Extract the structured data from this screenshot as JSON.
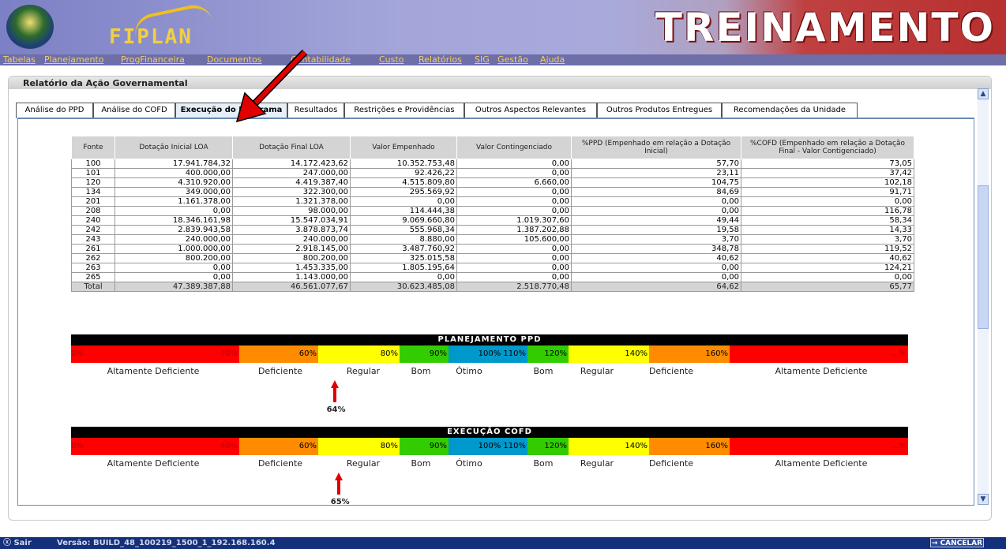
{
  "header": {
    "logo_text": "FIPLAN",
    "banner_text": "TREINAMENTO"
  },
  "menu": [
    "Tabelas",
    "Planejamento",
    "ProgFinanceira",
    "Documentos",
    "Contabilidade",
    "Custo",
    "Relatórios",
    "SIG",
    "Gestão",
    "Ajuda"
  ],
  "panel": {
    "title": "Relatório da Ação Governamental"
  },
  "tabs": [
    {
      "label": "Análise do PPD",
      "active": false
    },
    {
      "label": "Análise do COFD",
      "active": false
    },
    {
      "label": "Execução do Programa",
      "active": true
    },
    {
      "label": "Resultados",
      "active": false
    },
    {
      "label": "Restrições e Providências",
      "active": false
    },
    {
      "label": "Outros Aspectos Relevantes",
      "active": false
    },
    {
      "label": "Outros Produtos Entregues",
      "active": false
    },
    {
      "label": "Recomendações da Unidade",
      "active": false
    }
  ],
  "table": {
    "headers": [
      "Fonte",
      "Dotação Inicial LOA",
      "Dotação Final LOA",
      "Valor Empenhado",
      "Valor Contingenciado",
      "%PPD (Empenhado em relação a Dotação Inicial)",
      "%COFD (Empenhado em relação a Dotação Final - Valor Contigenciado)"
    ],
    "rows": [
      [
        "100",
        "17.941.784,32",
        "14.172.423,62",
        "10.352.753,48",
        "0,00",
        "57,70",
        "73,05"
      ],
      [
        "101",
        "400.000,00",
        "247.000,00",
        "92.426,22",
        "0,00",
        "23,11",
        "37,42"
      ],
      [
        "120",
        "4.310.920,00",
        "4.419.387,40",
        "4.515.809,80",
        "6.660,00",
        "104,75",
        "102,18"
      ],
      [
        "134",
        "349.000,00",
        "322.300,00",
        "295.569,92",
        "0,00",
        "84,69",
        "91,71"
      ],
      [
        "201",
        "1.161.378,00",
        "1.321.378,00",
        "0,00",
        "0,00",
        "0,00",
        "0,00"
      ],
      [
        "208",
        "0,00",
        "98.000,00",
        "114.444,38",
        "0,00",
        "0,00",
        "116,78"
      ],
      [
        "240",
        "18.346.161,98",
        "15.547.034,91",
        "9.069.660,80",
        "1.019.307,60",
        "49,44",
        "58,34"
      ],
      [
        "242",
        "2.839.943,58",
        "3.878.873,74",
        "555.968,34",
        "1.387.202,88",
        "19,58",
        "14,33"
      ],
      [
        "243",
        "240.000,00",
        "240.000,00",
        "8.880,00",
        "105.600,00",
        "3,70",
        "3,70"
      ],
      [
        "261",
        "1.000.000,00",
        "2.918.145,00",
        "3.487.760,92",
        "0,00",
        "348,78",
        "119,52"
      ],
      [
        "262",
        "800.200,00",
        "800.200,00",
        "325.015,58",
        "0,00",
        "40,62",
        "40,62"
      ],
      [
        "263",
        "0,00",
        "1.453.335,00",
        "1.805.195,64",
        "0,00",
        "0,00",
        "124,21"
      ],
      [
        "265",
        "0,00",
        "1.143.000,00",
        "0,00",
        "0,00",
        "0,00",
        "0,00"
      ]
    ],
    "total": [
      "Total",
      "47.389.387,88",
      "46.561.077,67",
      "30.623.485,08",
      "2.518.770,48",
      "64,62",
      "65,77"
    ]
  },
  "scale_segments": [
    {
      "label": "40%",
      "start": "0%",
      "color": "#ff0000"
    },
    {
      "label": "60%",
      "color": "#ff8c00"
    },
    {
      "label": "80%",
      "color": "#ffff00"
    },
    {
      "label": "90%",
      "color": "#33cc00"
    },
    {
      "label": "100%  110%",
      "color": "#0099cc"
    },
    {
      "label": "120%",
      "color": "#33cc00"
    },
    {
      "label": "140%",
      "color": "#ffff00"
    },
    {
      "label": "160%",
      "color": "#ff8c00"
    },
    {
      "label": "...%",
      "color": "#ff0000"
    }
  ],
  "scale_labels": [
    "Altamente Deficiente",
    "Deficiente",
    "Regular",
    "Bom",
    "Ótimo",
    "Bom",
    "Regular",
    "Deficiente",
    "Altamente Deficiente"
  ],
  "scales": [
    {
      "title": "PLANEJAMENTO PPD",
      "percent": "64%",
      "value": 64
    },
    {
      "title": "EXECUÇÃO COFD",
      "percent": "65%",
      "value": 65
    }
  ],
  "footer": {
    "exit_label": "Sair",
    "version": "Versão: BUILD_48_100219_1500_1_192.168.160.4",
    "cancel_label": "→ CANCELAR"
  }
}
